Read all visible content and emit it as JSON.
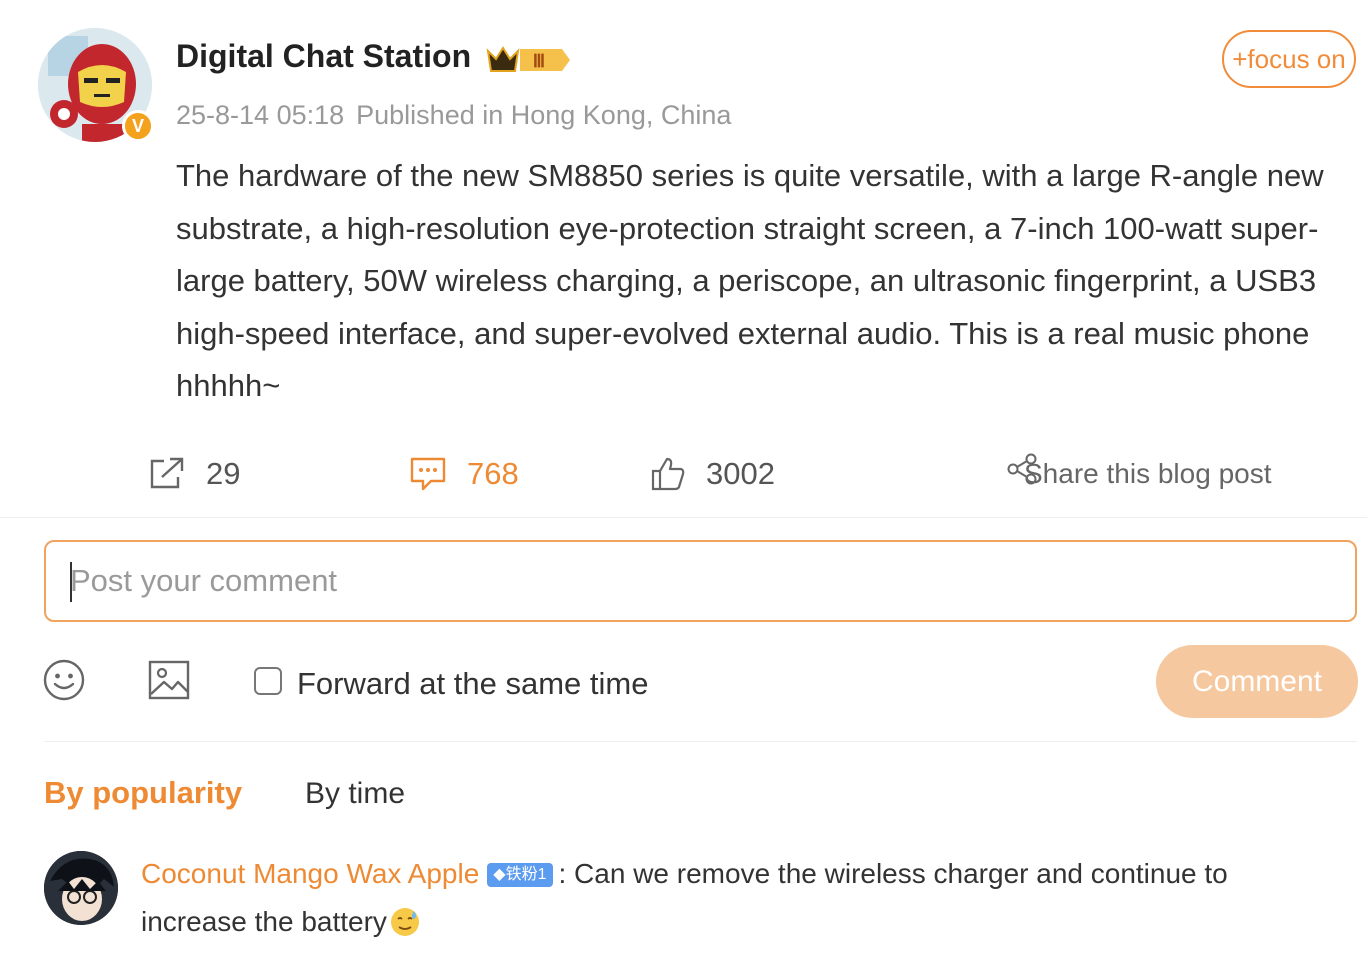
{
  "post": {
    "author": "Digital Chat Station",
    "verified_badge": "V",
    "crown_level": "Ⅲ",
    "timestamp": "25-8-14 05:18",
    "location": "Published in Hong Kong, China",
    "follow_label": "+focus on",
    "body": "The hardware of the new SM8850 series is quite versatile, with a large R-angle new substrate, a high-resolution eye-protection straight screen, a 7-inch 100-watt super-large battery, 50W wireless charging, a periscope, an ultrasonic fingerprint, a USB3 high-speed interface, and super-evolved external audio. This is a real music phone hhhhh~"
  },
  "actions": {
    "reposts": "29",
    "comments": "768",
    "likes": "3002",
    "share_label": "Share this blog post"
  },
  "composer": {
    "placeholder": "Post your comment",
    "forward_label": "Forward at the same time",
    "submit_label": "Comment"
  },
  "sort": {
    "popularity": "By popularity",
    "time": "By time"
  },
  "comments": [
    {
      "user": "Coconut Mango Wax Apple",
      "fan_badge": "◆铁粉1",
      "text": ": Can we remove the wireless charger and continue to increase the battery"
    }
  ],
  "colors": {
    "accent": "#ee8a33",
    "button_disabled": "#f6c89f",
    "muted_text": "#999999",
    "fan_badge": "#5b9bf0"
  }
}
